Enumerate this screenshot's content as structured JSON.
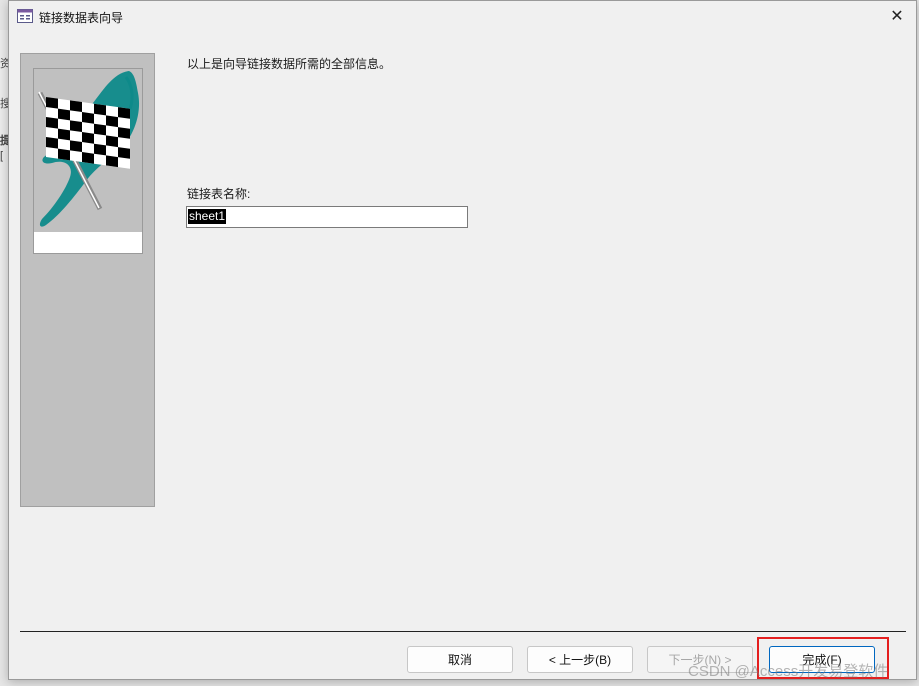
{
  "window": {
    "title": "链接数据表向导",
    "close_label": "✕"
  },
  "backdrop_fragments": [
    "资",
    "搜",
    "提",
    "["
  ],
  "wizard": {
    "info_text": "以上是向导链接数据所需的全部信息。",
    "name_label": "链接表名称:",
    "name_value": "sheet1"
  },
  "buttons": {
    "cancel": "取消",
    "back": "< 上一步(B)",
    "next": "下一步(N) >",
    "finish": "完成(F)"
  },
  "watermark": "CSDN @Access开发易登软件",
  "colors": {
    "highlight": "#e41e1e",
    "default_button_border": "#0067c0",
    "flag_teal": "#0e8a8a"
  }
}
